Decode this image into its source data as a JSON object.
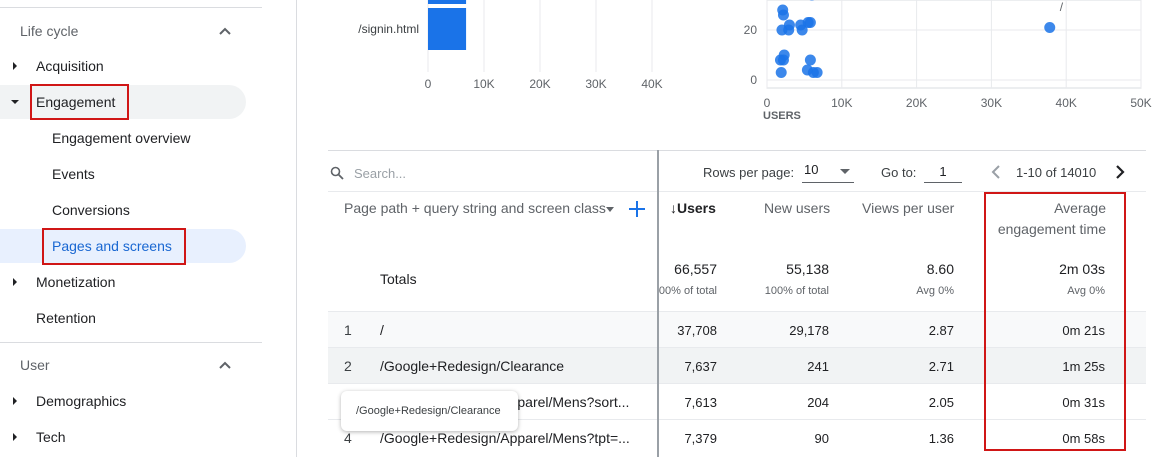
{
  "sidebar": {
    "sections": [
      {
        "label": "Life cycle"
      },
      {
        "label": "User"
      }
    ],
    "items": [
      {
        "label": "Acquisition"
      },
      {
        "label": "Engagement"
      },
      {
        "label": "Engagement overview"
      },
      {
        "label": "Events"
      },
      {
        "label": "Conversions"
      },
      {
        "label": "Pages and screens"
      },
      {
        "label": "Monetization"
      },
      {
        "label": "Retention"
      },
      {
        "label": "Demographics"
      },
      {
        "label": "Tech"
      }
    ]
  },
  "bar_chart": {
    "type": "bar",
    "categories": [
      "/signin.html"
    ],
    "values": [
      6800
    ],
    "xticks": [
      "0",
      "10K",
      "20K",
      "30K",
      "40K"
    ],
    "xlim": [
      0,
      43000
    ]
  },
  "scatter_chart": {
    "type": "scatter",
    "x_label": "USERS",
    "xticks": [
      "0",
      "10K",
      "20K",
      "30K",
      "40K",
      "50K"
    ],
    "yticks": [
      "0",
      "20"
    ],
    "xlim": [
      0,
      50000
    ],
    "ylim": [
      0,
      40
    ],
    "annotation": "/",
    "points": [
      {
        "x": 2100,
        "y": 28
      },
      {
        "x": 2200,
        "y": 26
      },
      {
        "x": 2000,
        "y": 20
      },
      {
        "x": 2900,
        "y": 20
      },
      {
        "x": 3000,
        "y": 22
      },
      {
        "x": 2300,
        "y": 10
      },
      {
        "x": 1800,
        "y": 8
      },
      {
        "x": 2200,
        "y": 8
      },
      {
        "x": 1900,
        "y": 3
      },
      {
        "x": 4500,
        "y": 22
      },
      {
        "x": 4700,
        "y": 20
      },
      {
        "x": 5500,
        "y": 23
      },
      {
        "x": 5800,
        "y": 23
      },
      {
        "x": 5800,
        "y": 8
      },
      {
        "x": 5400,
        "y": 4
      },
      {
        "x": 6200,
        "y": 3
      },
      {
        "x": 6700,
        "y": 3
      },
      {
        "x": 6000,
        "y": 34
      },
      {
        "x": 37800,
        "y": 21
      }
    ]
  },
  "table": {
    "search_placeholder": "Search...",
    "rows_per_page_label": "Rows per page:",
    "rows_per_page_value": "10",
    "goto_label": "Go to:",
    "goto_value": "1",
    "range_text": "1-10 of 14010",
    "dimension_header": "Page path + query string and screen class",
    "headers": {
      "users": "Users",
      "new_users": "New users",
      "views_per_user": "Views per user",
      "avg_engagement_1": "Average",
      "avg_engagement_2": "engagement time"
    },
    "sort_arrow": "↓",
    "totals": {
      "label": "Totals",
      "users": "66,557",
      "users_sub": "00% of total",
      "new_users": "55,138",
      "new_users_sub": "100% of total",
      "views_per_user": "8.60",
      "views_per_user_sub": "Avg 0%",
      "avg_engagement": "2m 03s",
      "avg_engagement_sub": "Avg 0%"
    },
    "rows": [
      {
        "index": "1",
        "path": "/",
        "users": "37,708",
        "new_users": "29,178",
        "views_per_user": "2.87",
        "avg_engagement": "0m 21s"
      },
      {
        "index": "2",
        "path": "/Google+Redesign/Clearance",
        "users": "7,637",
        "new_users": "241",
        "views_per_user": "2.71",
        "avg_engagement": "1m 25s"
      },
      {
        "index": "3",
        "path": "/Google+Redesign/Apparel/Mens?sort...",
        "users": "7,613",
        "new_users": "204",
        "views_per_user": "2.05",
        "avg_engagement": "0m 31s"
      },
      {
        "index": "4",
        "path": "/Google+Redesign/Apparel/Mens?tpt=...",
        "users": "7,379",
        "new_users": "90",
        "views_per_user": "1.36",
        "avg_engagement": "0m 58s"
      }
    ],
    "tooltip": "/Google+Redesign/Clearance"
  }
}
